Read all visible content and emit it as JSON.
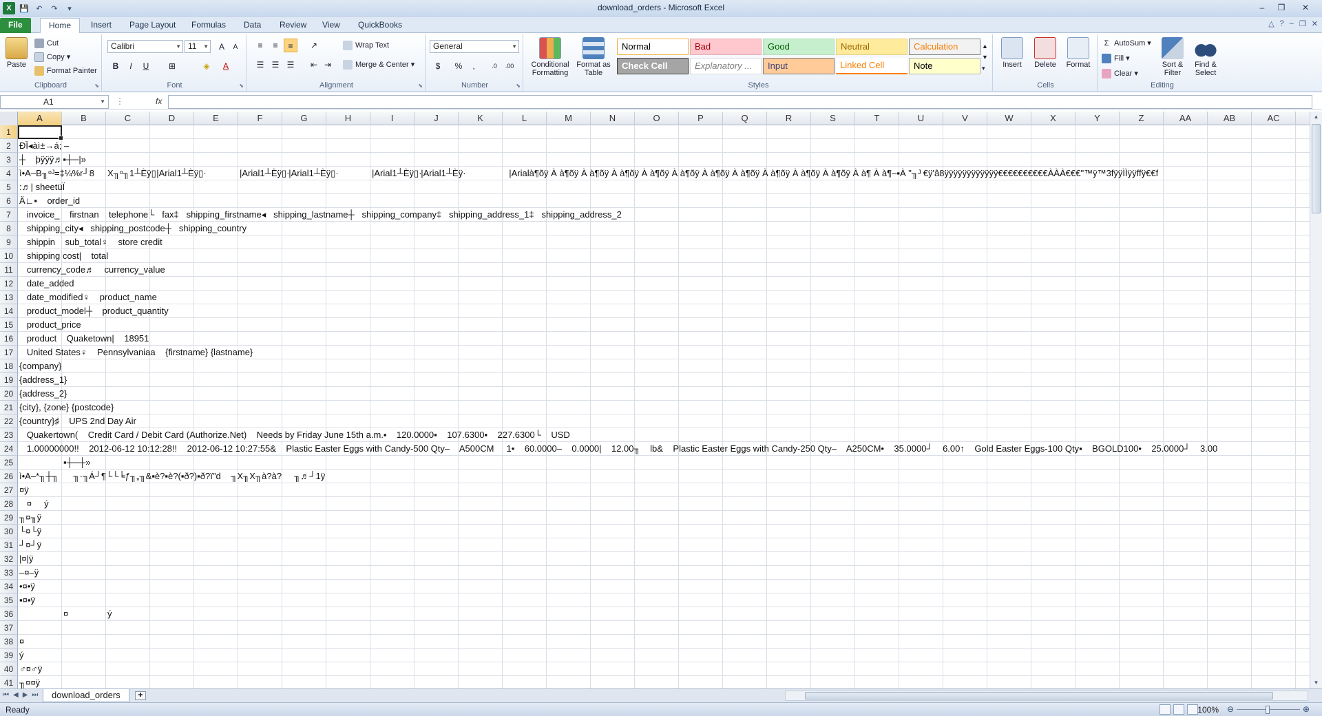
{
  "app": {
    "title": "download_orders - Microsoft Excel"
  },
  "qat": {
    "save": "💾",
    "undo": "↶",
    "redo": "↷",
    "more": "▾"
  },
  "tabs": [
    "File",
    "Home",
    "Insert",
    "Page Layout",
    "Formulas",
    "Data",
    "Review",
    "View",
    "QuickBooks"
  ],
  "ribbon": {
    "clipboard": {
      "label": "Clipboard",
      "paste": "Paste",
      "cut": "Cut",
      "copy": "Copy",
      "format_painter": "Format Painter"
    },
    "font": {
      "label": "Font",
      "name": "Calibri",
      "size": "11"
    },
    "alignment": {
      "label": "Alignment",
      "wrap_text": "Wrap Text",
      "merge_center": "Merge & Center"
    },
    "number": {
      "label": "Number",
      "format": "General"
    },
    "styles": {
      "label": "Styles",
      "conditional_formatting": "Conditional Formatting",
      "format_as_table": "Format as Table",
      "items": [
        {
          "name": "Normal",
          "bg": "#ffffff",
          "fg": "#000000",
          "border": "#f0b040"
        },
        {
          "name": "Bad",
          "bg": "#ffc7ce",
          "fg": "#9c0006",
          "border": "#e0b0b8"
        },
        {
          "name": "Good",
          "bg": "#c6efce",
          "fg": "#006100",
          "border": "#b0dcb8"
        },
        {
          "name": "Neutral",
          "bg": "#ffeb9c",
          "fg": "#9c6500",
          "border": "#e5d08a"
        },
        {
          "name": "Calculation",
          "bg": "#f2f2f2",
          "fg": "#fa7d00",
          "border": "#7f7f7f"
        },
        {
          "name": "Check Cell",
          "bg": "#a5a5a5",
          "fg": "#ffffff",
          "border": "#3f3f3f"
        },
        {
          "name": "Explanatory ...",
          "bg": "#ffffff",
          "fg": "#7f7f7f",
          "border": "#dddddd"
        },
        {
          "name": "Input",
          "bg": "#ffcc99",
          "fg": "#3f3f76",
          "border": "#7f7f7f"
        },
        {
          "name": "Linked Cell",
          "bg": "#ffffff",
          "fg": "#fa7d00",
          "border": "#ff8001"
        },
        {
          "name": "Note",
          "bg": "#ffffcc",
          "fg": "#000000",
          "border": "#b2b2b2"
        }
      ]
    },
    "cells": {
      "label": "Cells",
      "insert": "Insert",
      "delete": "Delete",
      "format": "Format"
    },
    "editing": {
      "label": "Editing",
      "autosum": "AutoSum",
      "fill": "Fill",
      "clear": "Clear",
      "sort_filter": "Sort & Filter",
      "find_select": "Find & Select"
    }
  },
  "formula_bar": {
    "name_box": "A1",
    "fx": "fx",
    "value": ""
  },
  "columns": [
    "A",
    "B",
    "C",
    "D",
    "E",
    "F",
    "G",
    "H",
    "I",
    "J",
    "K",
    "L",
    "M",
    "N",
    "O",
    "P",
    "Q",
    "R",
    "S",
    "T",
    "U",
    "V",
    "W",
    "X",
    "Y",
    "Z",
    "AA",
    "AB",
    "AC"
  ],
  "rows": [
    "1",
    "2",
    "3",
    "4",
    "5",
    "6",
    "7",
    "8",
    "9",
    "10",
    "11",
    "12",
    "13",
    "14",
    "15",
    "16",
    "17",
    "18",
    "19",
    "20",
    "21",
    "22",
    "23",
    "24",
    "25",
    "26",
    "27",
    "28",
    "29",
    "30",
    "31",
    "32",
    "33",
    "34",
    "35",
    "36",
    "37",
    "38",
    "39",
    "40",
    "41"
  ],
  "sheet": {
    "cells": [
      {
        "r": 2,
        "c": 0,
        "t": "ÐÏ◂àì±→á; –"
      },
      {
        "r": 3,
        "c": 0,
        "t": "┼    þÿÿÿ♬▪┼─|»"
      },
      {
        "r": 4,
        "c": 0,
        "t": "ì•A–B╖ᵒᴶ=‡¼%r┘8"
      },
      {
        "r": 4,
        "c": 2,
        "t": "X╖ᵒ╖1┴Èÿ▯"
      },
      {
        "r": 4,
        "c": 3,
        "t": "  |Arial1┴Èÿ▯·"
      },
      {
        "r": 4,
        "c": 5,
        "t": "|Arial1┴Èÿ▯·"
      },
      {
        "r": 4,
        "c": 6,
        "t": "  |Arial1┴Èÿ▯·"
      },
      {
        "r": 4,
        "c": 8,
        "t": "|Arial1┴Èÿ▯·"
      },
      {
        "r": 4,
        "c": 9,
        "t": "  |Arial1┴Èÿ·"
      },
      {
        "r": 4,
        "c": 11,
        "t": "  |Arialà¶õÿ À à¶õÿ À à¶õÿ À à¶õÿ À à¶õÿ À à¶õÿ À à¶õÿ À à¶õÿ À à¶õÿ À à¶õÿ À à¶õÿ À à¶ À à¶–▪À \"╖ᴶ €ÿ'â8ÿÿÿÿÿÿÿÿÿÿÿÿ€€€€€€€€€€ÀÀÀ€€€\"™ÿ™3fÿÿÌÌÿÿffÿ€€f"
      },
      {
        "r": 5,
        "c": 0,
        "t": ":♬| sheetüÏ"
      },
      {
        "r": 6,
        "c": 0,
        "t": "Ä∟▪    order_id"
      },
      {
        "r": 7,
        "c": 0,
        "t": "   invoice_    firstnan    telephone└   fax‡   shipping_firstname◂   shipping_lastname┼   shipping_company‡   shipping_address_1‡   shipping_address_2"
      },
      {
        "r": 8,
        "c": 0,
        "t": "   shipping_city◂   shipping_postcode┼   shipping_country"
      },
      {
        "r": 9,
        "c": 0,
        "t": "   shippin    sub_total♀    store credit"
      },
      {
        "r": 10,
        "c": 0,
        "t": "   shipping cost|    total"
      },
      {
        "r": 11,
        "c": 0,
        "t": "   currency_code♬    currency_value"
      },
      {
        "r": 12,
        "c": 0,
        "t": "   date_added"
      },
      {
        "r": 13,
        "c": 0,
        "t": "   date_modified♀    product_name"
      },
      {
        "r": 14,
        "c": 0,
        "t": "   product_model┼    product_quantity"
      },
      {
        "r": 15,
        "c": 0,
        "t": "   product_price"
      },
      {
        "r": 16,
        "c": 0,
        "t": "   product    Quaketown|    18951"
      },
      {
        "r": 17,
        "c": 0,
        "t": "   United States♀    Pennsylvaniaa    {firstname} {lastname}"
      },
      {
        "r": 18,
        "c": 0,
        "t": "{company}"
      },
      {
        "r": 19,
        "c": 0,
        "t": "{address_1}"
      },
      {
        "r": 20,
        "c": 0,
        "t": "{address_2}"
      },
      {
        "r": 21,
        "c": 0,
        "t": "{city}, {zone} {postcode}"
      },
      {
        "r": 22,
        "c": 0,
        "t": "{country}♯    UPS 2nd Day Air"
      },
      {
        "r": 23,
        "c": 0,
        "t": "   Quakertown(    Credit Card / Debit Card (Authorize.Net)    Needs by Friday June 15th a.m.▪    120.0000▪    107.6300▪    227.6300└    USD"
      },
      {
        "r": 24,
        "c": 0,
        "t": "   1.00000000!!    2012-06-12 10:12:28!!    2012-06-12 10:27:55&    Plastic Easter Eggs with Candy-500 Qty–    A500CM     1•    60.0000–    0.0000|    12.00╖    lb&    Plastic Easter Eggs with Candy-250 Qty–    A250CM•    35.0000┘    6.00↑    Gold Easter Eggs-100 Qty▪    BGOLD100•    25.0000┘    3.00"
      },
      {
        "r": 25,
        "c": 1,
        "t": "▪┼─┼»"
      },
      {
        "r": 26,
        "c": 0,
        "t": "ì•A–*╖┼╖      ╖·╖Á┘¶└└╘ƒ╖„╖&▪è?▪è?(▪ð?)▪ð?ï\"d    ╖X╖X╖à?à?     ╖♬┘1ÿ"
      },
      {
        "r": 27,
        "c": 0,
        "t": "¤ÿ"
      },
      {
        "r": 28,
        "c": 0,
        "t": "   ¤     ý"
      },
      {
        "r": 29,
        "c": 0,
        "t": "╖¤╖ÿ"
      },
      {
        "r": 30,
        "c": 0,
        "t": "└¤└ÿ"
      },
      {
        "r": 31,
        "c": 0,
        "t": "┘¤┘ÿ"
      },
      {
        "r": 32,
        "c": 0,
        "t": "|¤|ÿ"
      },
      {
        "r": 33,
        "c": 0,
        "t": "–¤–ÿ"
      },
      {
        "r": 34,
        "c": 0,
        "t": "•¤•ÿ"
      },
      {
        "r": 35,
        "c": 0,
        "t": "▪¤▪ÿ"
      },
      {
        "r": 36,
        "c": 1,
        "t": "¤"
      },
      {
        "r": 36,
        "c": 2,
        "t": "ý"
      },
      {
        "r": 38,
        "c": 0,
        "t": "¤"
      },
      {
        "r": 39,
        "c": 0,
        "t": "ý"
      },
      {
        "r": 40,
        "c": 0,
        "t": "♂¤♂ÿ"
      },
      {
        "r": 41,
        "c": 0,
        "t": "╖¤¤ÿ"
      }
    ]
  },
  "sheet_tab": "download_orders",
  "status": {
    "text": "Ready",
    "zoom": "100%"
  }
}
